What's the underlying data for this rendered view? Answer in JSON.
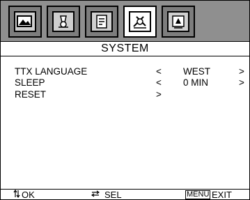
{
  "tabs": [
    {
      "icon": "picture-icon",
      "active": false
    },
    {
      "icon": "sound-icon",
      "active": false
    },
    {
      "icon": "feature-icon",
      "active": false
    },
    {
      "icon": "system-icon",
      "active": true
    },
    {
      "icon": "channel-icon",
      "active": false
    }
  ],
  "menu_title": "SYSTEM",
  "items": [
    {
      "label": "TTX LANGUAGE",
      "left_arrow": "<",
      "value": "WEST",
      "right_arrow": ">"
    },
    {
      "label": "SLEEP",
      "left_arrow": "<",
      "value": "0 MIN",
      "right_arrow": ">"
    },
    {
      "label": "RESET",
      "left_arrow": ">",
      "value": "",
      "right_arrow": ""
    }
  ],
  "footer": {
    "ok_icon": "up-down-arrows-icon",
    "ok_label": "OK",
    "sel_icon": "left-right-arrows-icon",
    "sel_label": "SEL",
    "menu_key": "MENU",
    "exit_label": "EXIT"
  }
}
